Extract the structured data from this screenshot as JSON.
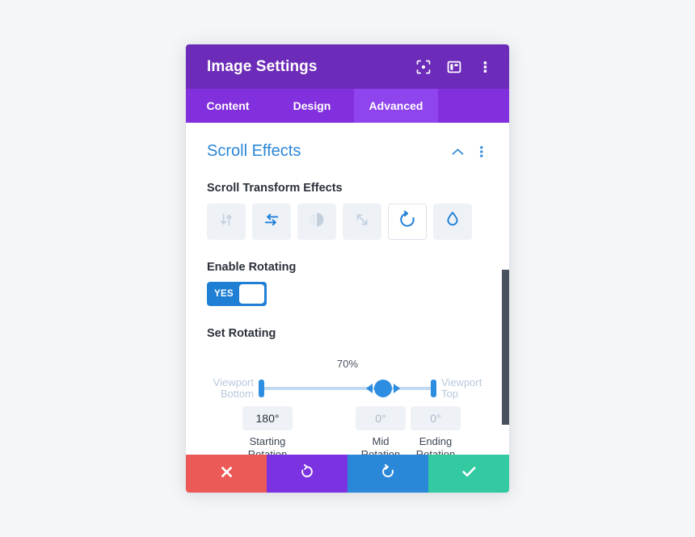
{
  "window": {
    "title": "Image Settings",
    "header_icons": [
      {
        "name": "focus-target-icon",
        "label": "Focus"
      },
      {
        "name": "layout-panel-icon",
        "label": "Layout"
      },
      {
        "name": "more-options-icon",
        "label": "More Options"
      }
    ]
  },
  "tabs": [
    {
      "label": "Content",
      "active": false
    },
    {
      "label": "Design",
      "active": false
    },
    {
      "label": "Advanced",
      "active": true
    }
  ],
  "section": {
    "title": "Scroll Effects",
    "collapse_icon": "chevron-up-icon",
    "menu_icon": "more-options-icon"
  },
  "transform_effects": {
    "label": "Scroll Transform Effects",
    "items": [
      {
        "name": "vertical-motion",
        "icon": "up-down-arrows-icon",
        "state": "inactive"
      },
      {
        "name": "horizontal-motion",
        "icon": "left-right-arrows-icon",
        "state": "active"
      },
      {
        "name": "fade-in-out",
        "icon": "opacity-fade-icon",
        "state": "inactive"
      },
      {
        "name": "scaling-up-down",
        "icon": "diagonal-resize-icon",
        "state": "inactive"
      },
      {
        "name": "rotating",
        "icon": "rotate-clockwise-icon",
        "state": "selected"
      },
      {
        "name": "blur",
        "icon": "water-drop-icon",
        "state": "active"
      }
    ]
  },
  "enable_rotating": {
    "label": "Enable Rotating",
    "toggle_value": "YES"
  },
  "set_rotating": {
    "label": "Set Rotating",
    "slider": {
      "percent_label": "70%",
      "percent_value": 70,
      "left_label": "Viewport\nBottom",
      "right_label": "Viewport\nTop"
    },
    "values": [
      {
        "value": "180°",
        "caption": "Starting\nRotation",
        "state": "active"
      },
      {
        "value": "0°",
        "caption": "Mid\nRotation",
        "state": "muted"
      },
      {
        "value": "0°",
        "caption": "Ending\nRotation",
        "state": "muted"
      }
    ]
  },
  "footer": [
    {
      "name": "cancel-button",
      "icon": "close-x-icon",
      "color": "#eb5a56"
    },
    {
      "name": "undo-button",
      "icon": "undo-arrow-icon",
      "color": "#7b32e0"
    },
    {
      "name": "redo-button",
      "icon": "redo-arrow-icon",
      "color": "#2b87d8"
    },
    {
      "name": "save-button",
      "icon": "checkmark-icon",
      "color": "#33c9a1"
    }
  ],
  "colors": {
    "header_purple": "#6c2bb9",
    "tabbar_purple": "#8230dd",
    "active_tab_purple": "#8f44ee",
    "section_blue": "#2a86d8",
    "accent_blue": "#2d8de0",
    "toggle_blue": "#1f7fd4",
    "track_blue": "#bfd9f2",
    "field_grey": "#eef2f7",
    "scrollbar_dark": "#48525f",
    "page_background": "#f5f6f8"
  }
}
